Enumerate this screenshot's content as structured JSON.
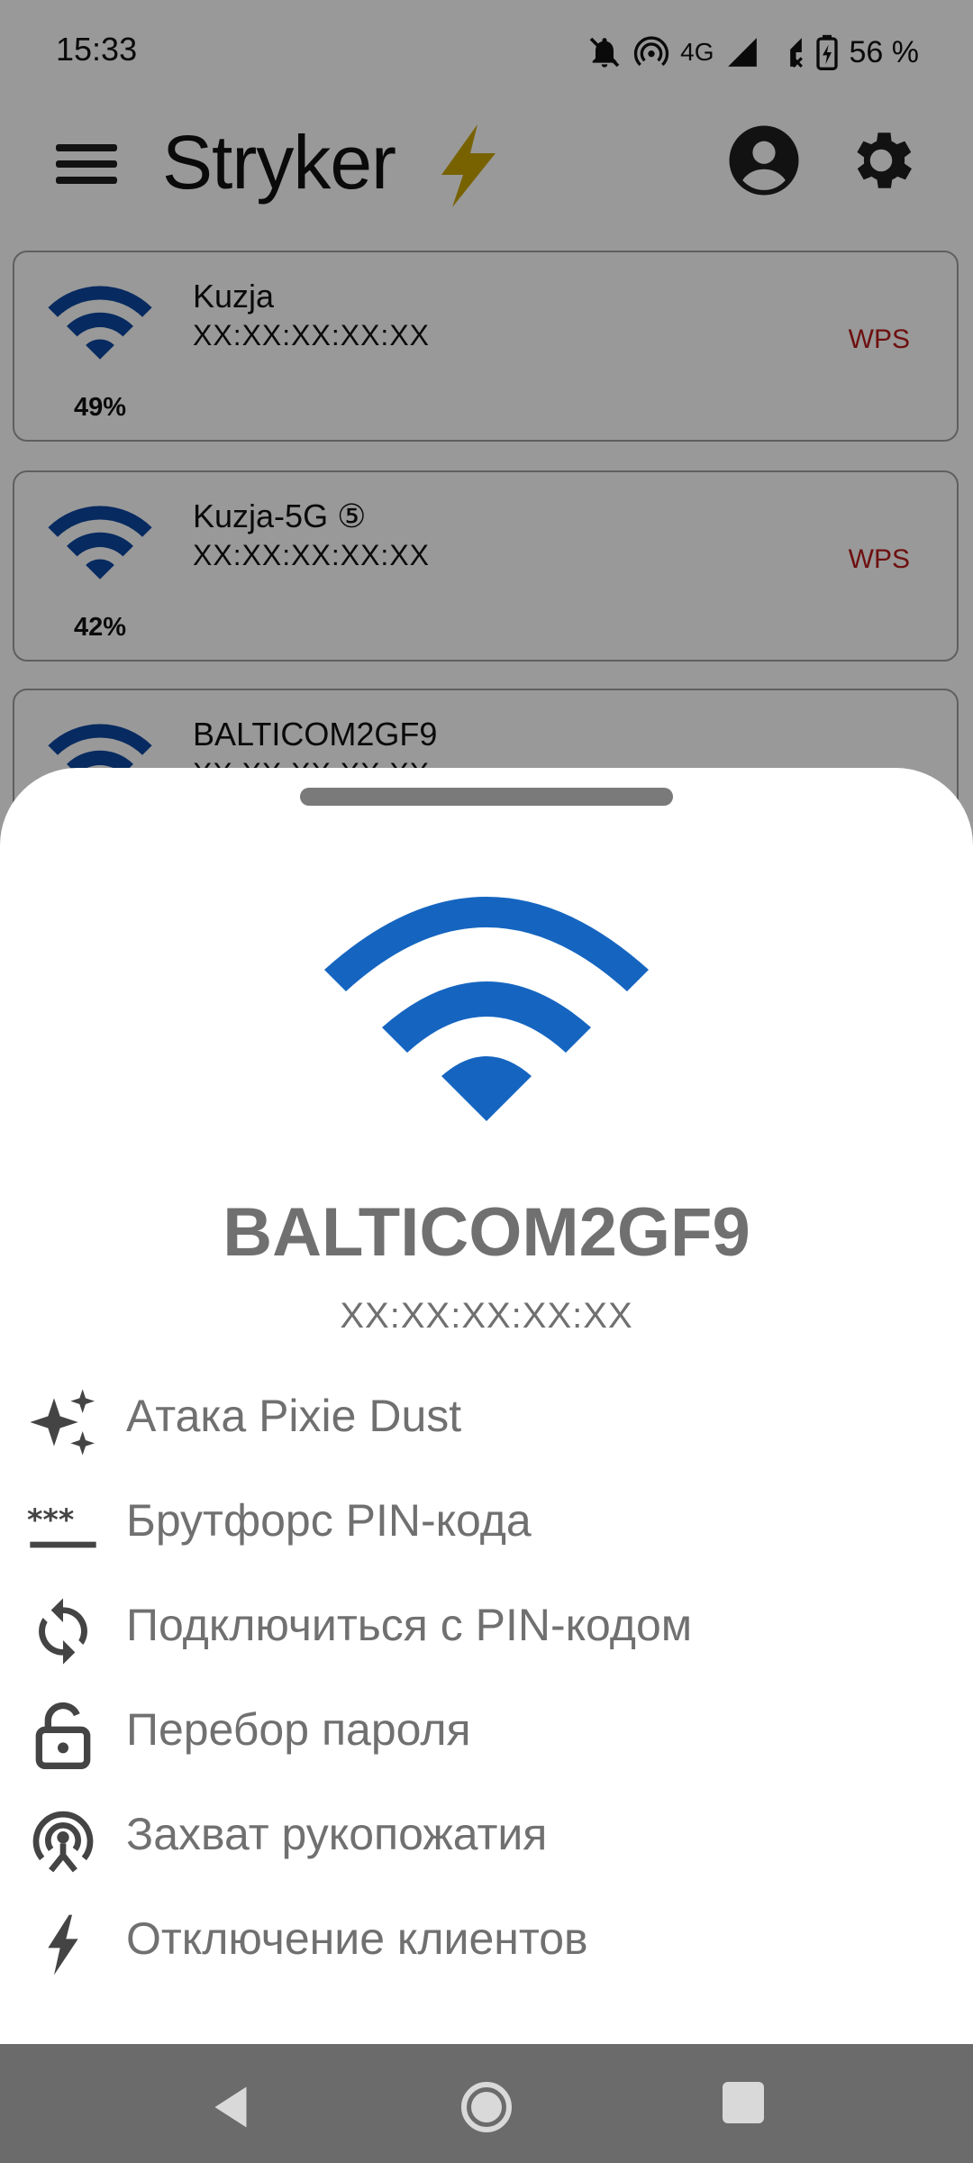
{
  "status_bar": {
    "time": "15:33",
    "network_type": "4G",
    "battery": "56 %",
    "icons": [
      "mute-notifications-icon",
      "hotspot-icon",
      "signal-icon",
      "no-signal-icon",
      "battery-charging-icon"
    ]
  },
  "toolbar": {
    "title": "Stryker",
    "logo_icon": "lightning-bolt-icon",
    "menu_icon": "hamburger-menu-icon",
    "account_icon": "account-circle-icon",
    "settings_icon": "gear-icon"
  },
  "networks": [
    {
      "ssid": "Kuzja",
      "bssid": "XX:XX:XX:XX:XX",
      "signal": "49%",
      "tag": "WPS"
    },
    {
      "ssid": "Kuzja-5G ⑤",
      "bssid": "XX:XX:XX:XX:XX",
      "signal": "42%",
      "tag": "WPS"
    },
    {
      "ssid": "BALTICOM2GF9",
      "bssid": "XX:XX:XX:XX:XX"
    }
  ],
  "sheet": {
    "ssid": "BALTICOM2GF9",
    "bssid": "XX:XX:XX:XX:XX",
    "accent_color": "#1565c0",
    "actions": [
      {
        "label": "Атака Pixie Dust",
        "icon": "sparkle-icon"
      },
      {
        "label": "Брутфорс PIN-кода",
        "icon": "password-icon"
      },
      {
        "label": "Подключиться с PIN-кодом",
        "icon": "sync-icon"
      },
      {
        "label": "Перебор пароля",
        "icon": "lock-open-icon"
      },
      {
        "label": "Захват рукопожатия",
        "icon": "wifi-tethering-icon"
      },
      {
        "label": "Отключение клиентов",
        "icon": "bolt-icon"
      }
    ]
  },
  "nav_bar": {
    "back_icon": "back-triangle-icon",
    "home_icon": "home-circle-icon",
    "recent_icon": "recent-apps-square-icon"
  }
}
